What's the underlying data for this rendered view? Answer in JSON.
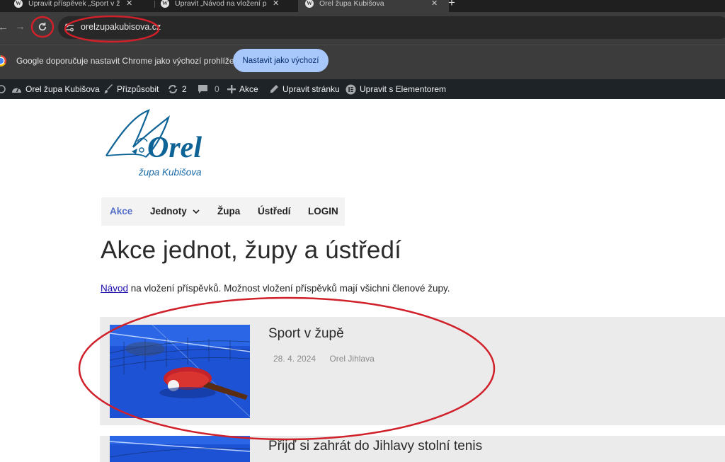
{
  "browser": {
    "tabs": [
      {
        "title": "Upravit příspěvek „Sport v župě",
        "active": false
      },
      {
        "title": "Upravit „Návod na vložení přís",
        "active": false
      },
      {
        "title": "Orel župa Kubišova",
        "active": true
      }
    ],
    "url": "orelzupakubisova.cz",
    "infobar": {
      "text": "Google doporučuje nastavit Chrome jako výchozí prohlížeč",
      "button": "Nastavit jako výchozí"
    }
  },
  "adminbar": {
    "site": "Orel župa Kubišova",
    "customize": "Přizpůsobit",
    "updates": "2",
    "comments": "0",
    "new": "Akce",
    "edit_page": "Upravit stránku",
    "elementor": "Upravit s Elementorem"
  },
  "site": {
    "logo_word": "Orel",
    "logo_subtitle": "župa Kubišova",
    "menu": [
      {
        "label": "Akce",
        "active": true
      },
      {
        "label": "Jednoty",
        "active": false,
        "has_submenu": true
      },
      {
        "label": "Župa",
        "active": false
      },
      {
        "label": "Ústředí",
        "active": false
      },
      {
        "label": "LOGIN",
        "active": false
      }
    ],
    "page_title": "Akce jednot, župy a ústředí",
    "lead_link": "Návod",
    "lead_text": " na vložení příspěvků. Možnost vložení příspěvků mají všichni členové župy.",
    "posts": [
      {
        "title": "Sport v župě",
        "date": "28. 4. 2024",
        "author": "Orel Jihlava"
      },
      {
        "title": "Přijď si zahrát do Jihlavy stolní tenis"
      }
    ]
  },
  "colors": {
    "annotation": "#d0202a",
    "menu_active": "#5670c9",
    "info_button": "#a8c7fa"
  }
}
